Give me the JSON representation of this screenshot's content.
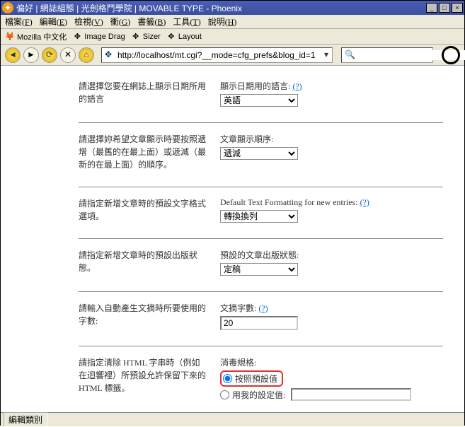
{
  "window": {
    "title": "偏好 | 網誌組態 | 光劍格鬥學院 | MOVABLE TYPE - Phoenix",
    "min": "_",
    "max": "□",
    "close": "×"
  },
  "menu": {
    "file": "檔案(",
    "file_u": "F",
    "file2": ")",
    "edit": "編輯(",
    "edit_u": "E",
    "edit2": ")",
    "view": "檢視(",
    "view_u": "V",
    "view2": ")",
    "go": "衝(",
    "go_u": "G",
    "go2": ")",
    "bookmark": "書籤(",
    "bookmark_u": "B",
    "bookmark2": ")",
    "tools": "工具(",
    "tools_u": "T",
    "tools2": ")",
    "help": "說明(",
    "help_u": "H",
    "help2": ")"
  },
  "tools": {
    "moz": "Mozilla 中文化",
    "img": "Image Drag",
    "siz": "Sizer",
    "lay": "Layout"
  },
  "nav": {
    "back": "◄",
    "fwd": "►",
    "reload": "⟳",
    "stop": "✕",
    "home": "⌂",
    "url": "http://localhost/mt.cgi?__mode=cfg_prefs&blog_id=1",
    "search_placeholder": "",
    "search_icon": "🔍"
  },
  "rows": {
    "lang": {
      "left": "請選擇您要在網誌上顯示日期所用的語言",
      "label": "顯示日期用的語言: ",
      "help": "(?)",
      "value": "英語"
    },
    "order": {
      "left": "請選擇妳希望文章顯示時要按照遞增（最舊的在最上面）或遞減（最新的在最上面）的順序。",
      "label": "文章顯示順序:",
      "value": "遞減"
    },
    "format": {
      "left": "請指定新增文章時的預設文字格式選項。",
      "label": "Default Text Formatting for new entries: ",
      "help": "(?)",
      "value": "轉換換列"
    },
    "status": {
      "left": "請指定新增文章時的預設出版狀態。",
      "label": "預設的文章出版狀態:",
      "value": "定稿"
    },
    "excerpt": {
      "left": "請輸入自動產生文摘時所要使用的字數:",
      "label": "文摘字數: ",
      "help": "(?)",
      "value": "20"
    },
    "sanitize": {
      "left": "請指定清除 HTML 字串時（例如在迴響裡）所預設允許保留下來的 HTML 標籤。",
      "label": "消毒規格:",
      "opt1": "按照預設值",
      "opt2": "用我的設定值:"
    }
  },
  "status": "編輯類別"
}
